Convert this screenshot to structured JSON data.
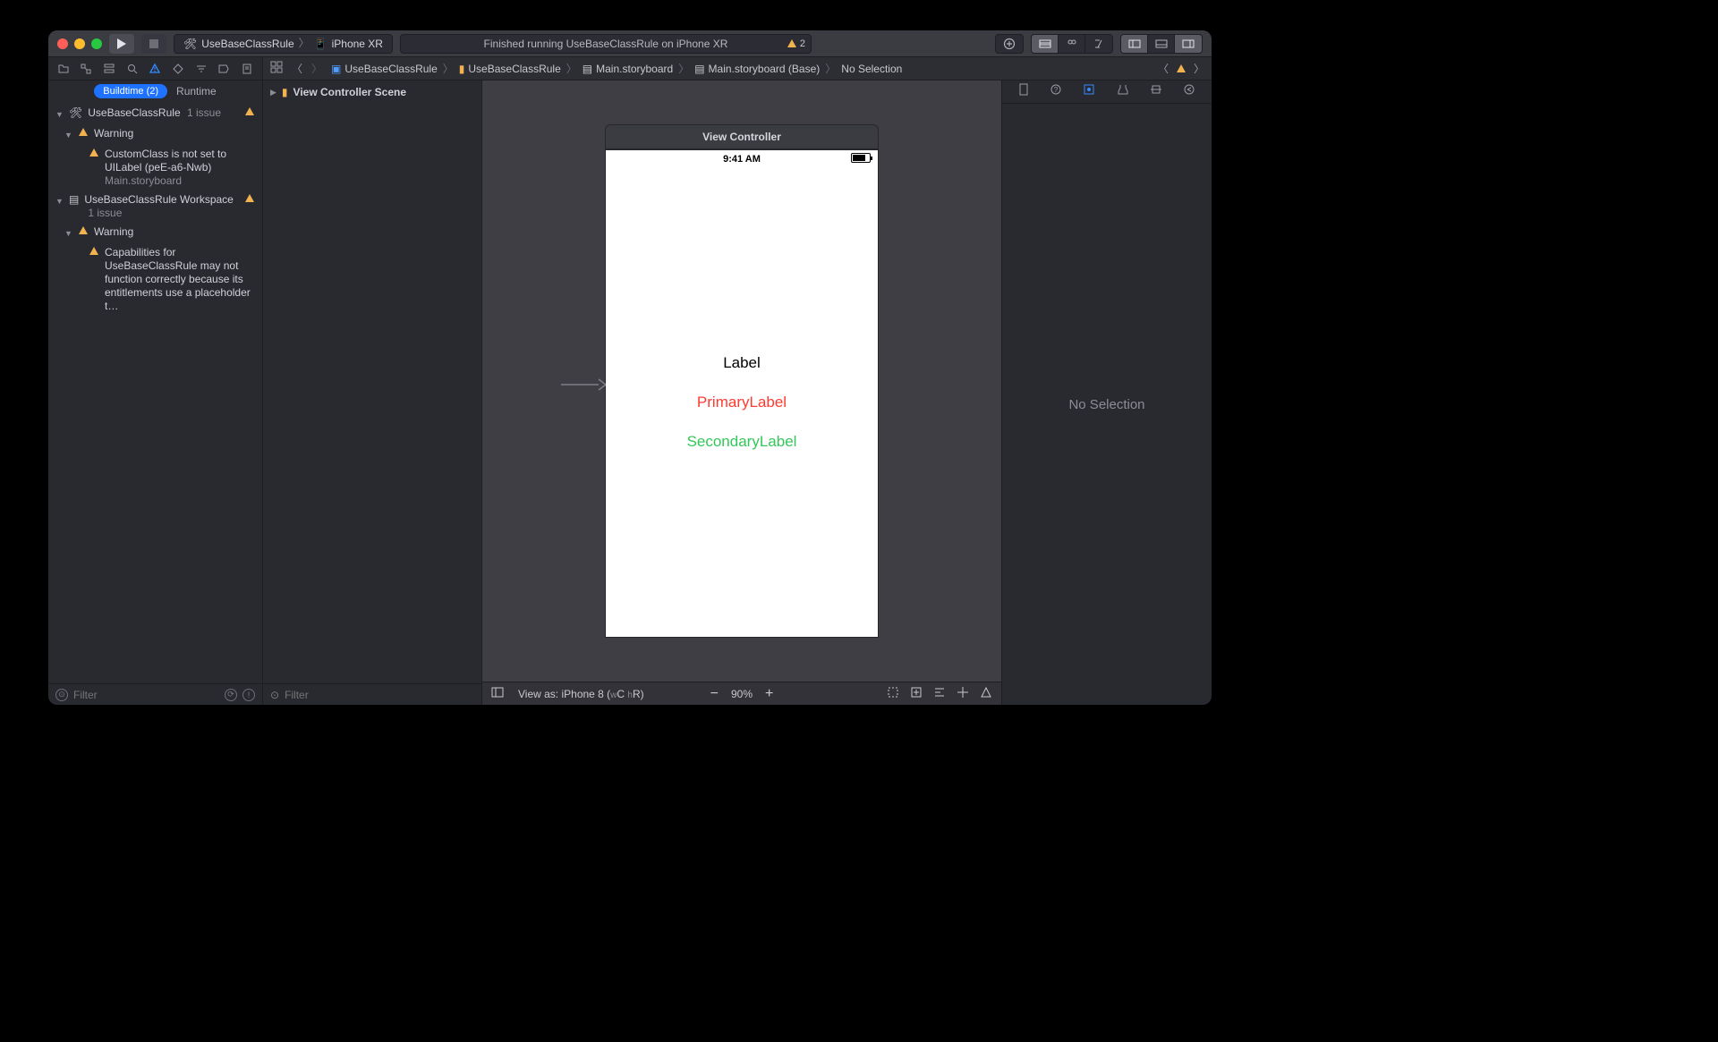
{
  "toolbar": {
    "scheme": {
      "project": "UseBaseClassRule",
      "device": "iPhone XR"
    },
    "status": {
      "text": "Finished running UseBaseClassRule on iPhone XR",
      "warn_count": "2"
    }
  },
  "nav_tabs": {
    "buildtime": "Buildtime (2)",
    "runtime": "Runtime"
  },
  "issues": {
    "project": {
      "name": "UseBaseClassRule",
      "count": "1 issue"
    },
    "warn_group1": "Warning",
    "issue1": {
      "title": "CustomClass is not set to UILabel (peE-a6-Nwb)",
      "sub": "Main.storyboard"
    },
    "workspace": {
      "name": "UseBaseClassRule Workspace",
      "count": "1 issue"
    },
    "warn_group2": "Warning",
    "issue2": {
      "title": "Capabilities for UseBaseClassRule may not function correctly because its entitlements use a placeholder t…"
    }
  },
  "filter_placeholder": "Filter",
  "outline": {
    "scene": "View Controller Scene"
  },
  "breadcrumb": {
    "p1": "UseBaseClassRule",
    "p2": "UseBaseClassRule",
    "p3": "Main.storyboard",
    "p4": "Main.storyboard (Base)",
    "p5": "No Selection"
  },
  "canvas": {
    "vc_title": "View Controller",
    "time": "9:41 AM",
    "label1": "Label",
    "label2": "PrimaryLabel",
    "label3": "SecondaryLabel",
    "view_as": "View as: iPhone 8 (",
    "view_as_w": "w",
    "view_as_c": "C ",
    "view_as_h": "h",
    "view_as_r": "R",
    "view_as_close": ")",
    "zoom": "90%"
  },
  "inspector": {
    "placeholder": "No Selection"
  }
}
